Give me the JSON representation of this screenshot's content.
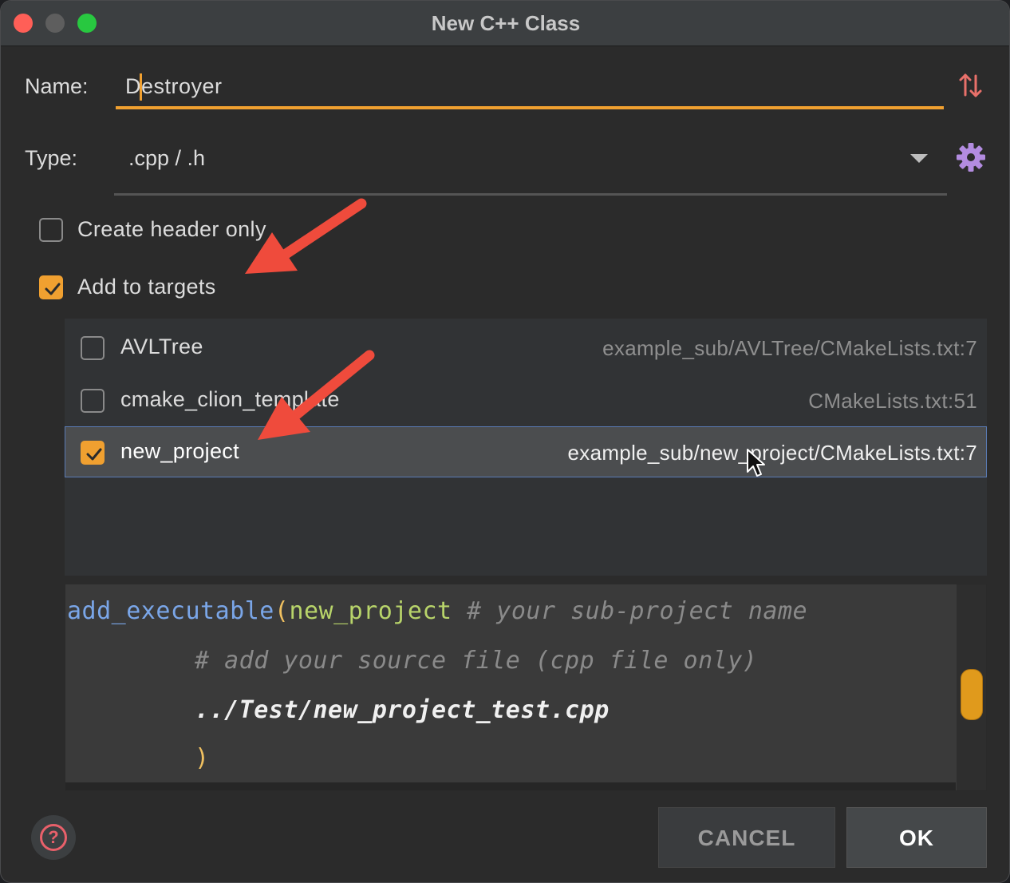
{
  "window": {
    "title": "New C++ Class"
  },
  "form": {
    "name_label": "Name:",
    "name_value": "Destroyer",
    "type_label": "Type:",
    "type_value": ".cpp / .h",
    "create_header_only": {
      "label": "Create header only",
      "checked": false
    },
    "add_to_targets": {
      "label": "Add to targets",
      "checked": true
    }
  },
  "targets": [
    {
      "name": "AVLTree",
      "path": "example_sub/AVLTree/CMakeLists.txt:7",
      "checked": false,
      "selected": false
    },
    {
      "name": "cmake_clion_template",
      "path": "CMakeLists.txt:51",
      "checked": false,
      "selected": false
    },
    {
      "name": "new_project",
      "path": "example_sub/new_project/CMakeLists.txt:7",
      "checked": true,
      "selected": true
    }
  ],
  "code": {
    "line1_fn": "add_executable",
    "line1_paren": "(",
    "line1_arg": "new_project",
    "line1_comment": " # your sub-project name",
    "line2_comment": "# add your source file (cpp file only)",
    "line3_path": "../Test/new_project_test.cpp",
    "line4_paren": ")"
  },
  "buttons": {
    "help": "?",
    "cancel": "CANCEL",
    "ok": "OK"
  },
  "colors": {
    "accent": "#f0a030",
    "annotation_arrow": "#ef4b3c"
  }
}
